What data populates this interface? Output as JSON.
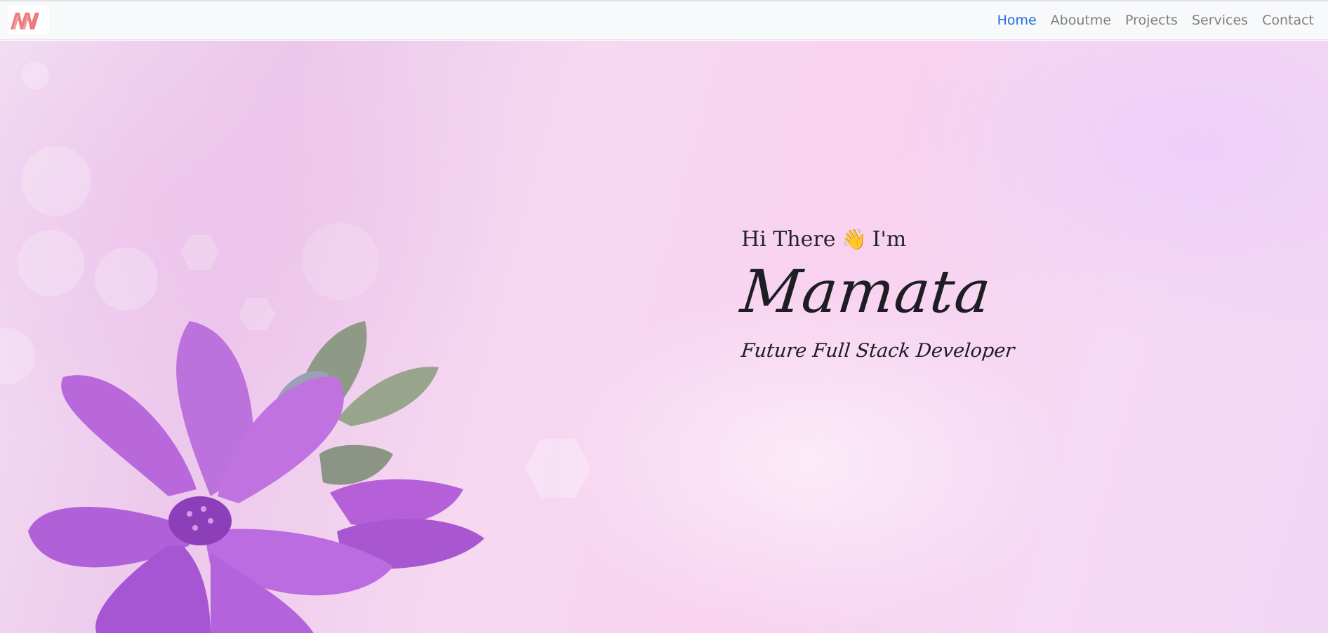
{
  "nav": {
    "logo_icon": "brand-logo-icon",
    "links": [
      {
        "label": "Home",
        "active": true
      },
      {
        "label": "Aboutme",
        "active": false
      },
      {
        "label": "Projects",
        "active": false
      },
      {
        "label": "Services",
        "active": false
      },
      {
        "label": "Contact",
        "active": false
      }
    ],
    "active_color": "#1b6fdc",
    "link_color": "#7f7f7f"
  },
  "hero": {
    "greeting_before": "Hi There",
    "wave_emoji": "👋",
    "greeting_after": "I'm",
    "name": "Mamata",
    "tagline": "Future Full Stack Developer",
    "background_image": "purple-flower-background"
  },
  "colors": {
    "brand": "#ee7b7b",
    "flower": "#b45fd6",
    "text": "#1e1d24"
  }
}
